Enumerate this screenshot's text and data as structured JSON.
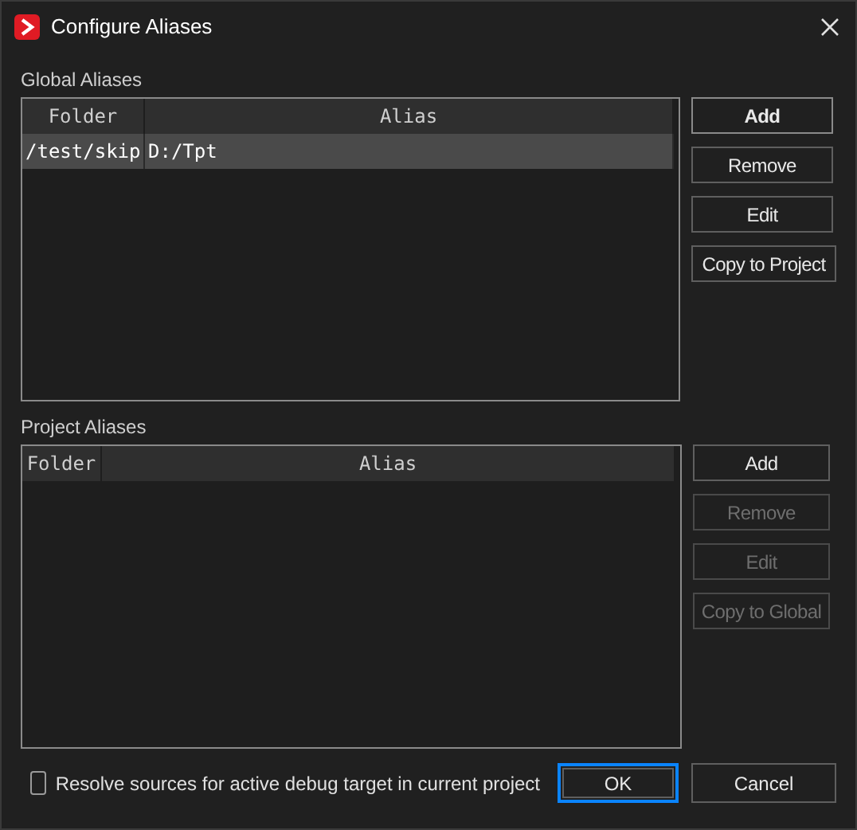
{
  "window": {
    "title": "Configure Aliases"
  },
  "global_aliases": {
    "label": "Global Aliases",
    "columns": [
      "Folder",
      "Alias"
    ],
    "rows": [
      {
        "cells": [
          "/test/skip",
          "D:/Tpt"
        ],
        "selected": true
      }
    ],
    "buttons": [
      {
        "label": "Add",
        "disabled": false,
        "default": true
      },
      {
        "label": "Remove",
        "disabled": false,
        "default": false
      },
      {
        "label": "Edit",
        "disabled": false,
        "default": false
      },
      {
        "label": "Copy to Project",
        "disabled": false,
        "default": false
      }
    ]
  },
  "project_aliases": {
    "label": "Project Aliases",
    "columns": [
      "Folder",
      "Alias"
    ],
    "buttons": [
      {
        "label": "Add",
        "disabled": false,
        "default": false
      },
      {
        "label": "Remove",
        "disabled": true,
        "default": false
      },
      {
        "label": "Edit",
        "disabled": true,
        "default": false
      },
      {
        "label": "Copy to Global",
        "disabled": true,
        "default": false
      }
    ]
  },
  "resolve_option": {
    "label": "Resolve sources for active debug target in current project",
    "checked": false
  },
  "dialog_buttons": [
    {
      "label": "OK",
      "focused": true
    },
    {
      "label": "Cancel",
      "focused": false
    }
  ]
}
